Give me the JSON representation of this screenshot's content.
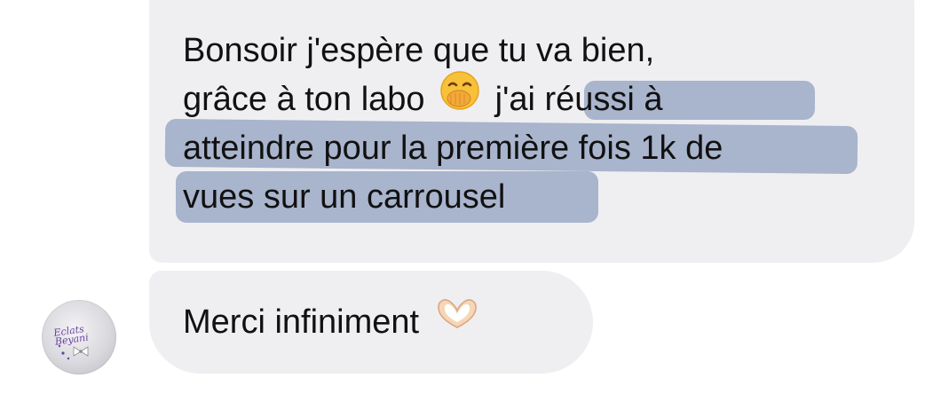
{
  "messages": [
    {
      "lines": [
        "Bonsoir j'espère que tu va bien,",
        "grâce à ton labo",
        "j'ai réussi à",
        "atteindre pour la première fois 1k de",
        "vues sur un carrousel"
      ],
      "emoji": "face-with-hand-over-mouth-icon"
    },
    {
      "text": "Merci infiniment",
      "emoji": "heart-hands-icon"
    }
  ],
  "avatar": {
    "label": "Eclats Beyani"
  },
  "colors": {
    "bubble": "#efeff2",
    "highlight": "#7084af",
    "text": "#111111"
  }
}
